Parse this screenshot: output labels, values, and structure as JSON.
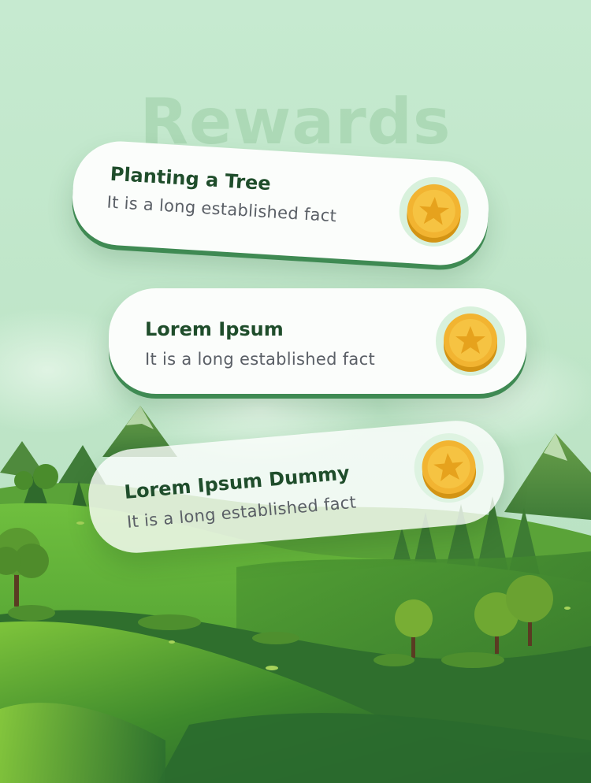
{
  "header": {
    "title": "Rewards"
  },
  "rewards": [
    {
      "title": "Planting a Tree",
      "subtitle": "It is a long established fact",
      "icon": "coin-star-icon"
    },
    {
      "title": "Lorem Ipsum",
      "subtitle": "It is a long established fact",
      "icon": "coin-star-icon"
    },
    {
      "title": "Lorem Ipsum Dummy",
      "subtitle": "It is a long established fact",
      "icon": "coin-star-icon"
    }
  ],
  "colors": {
    "background": "#bfe6c7",
    "card": "#fbfdfb",
    "title_text": "#1f4d2b",
    "subtitle_text": "#5a5f66",
    "card_shadow": "#3f8a53",
    "coin": "#f2b431"
  }
}
